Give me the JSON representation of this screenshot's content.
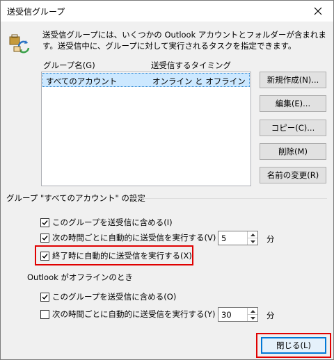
{
  "window": {
    "title": "送受信グループ"
  },
  "description": "送受信グループには、いくつかの Outlook アカウントとフォルダーが含まれます。送受信中に、グループに対して実行されるタスクを指定できます。",
  "list": {
    "col_name": "グループ名(G)",
    "col_timing": "送受信するタイミング",
    "rows": [
      {
        "name": "すべてのアカウント",
        "timing": "オンライン と オフライン",
        "selected": true
      }
    ]
  },
  "buttons": {
    "new": "新規作成(N)...",
    "edit": "編集(E)...",
    "copy": "コピー(C)...",
    "delete": "削除(M)",
    "rename": "名前の変更(R)"
  },
  "group_settings": {
    "title": "グループ \"すべてのアカウント\" の設定",
    "include": {
      "label": "このグループを送受信に含める(I)",
      "checked": true
    },
    "schedule": {
      "label": "次の時間ごとに自動的に送受信を実行する(V)",
      "checked": true,
      "minutes": "5",
      "unit": "分"
    },
    "on_exit": {
      "label": "終了時に自動的に送受信を実行する(X)",
      "checked": true
    }
  },
  "offline": {
    "title": "Outlook がオフラインのとき",
    "include": {
      "label": "このグループを送受信に含める(O)",
      "checked": true
    },
    "schedule": {
      "label": "次の時間ごとに自動的に送受信を実行する(Y)",
      "checked": false,
      "minutes": "30",
      "unit": "分"
    }
  },
  "close_button": "閉じる(L)",
  "colors": {
    "highlight": "#e00000",
    "selection": "#cce8ff",
    "focus": "#0078d7"
  }
}
